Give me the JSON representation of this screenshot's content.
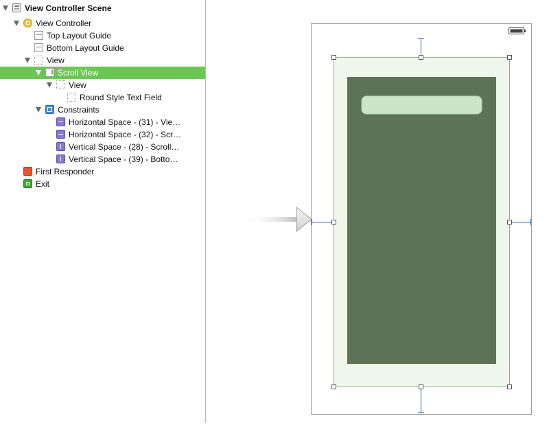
{
  "outline": {
    "items": [
      {
        "label": "View Controller Scene",
        "icon": "scene-icon",
        "level": 0,
        "expanded": true,
        "selected": false
      },
      {
        "label": "View Controller",
        "icon": "view-controller-icon",
        "level": 1,
        "expanded": true,
        "selected": false
      },
      {
        "label": "Top Layout Guide",
        "icon": "layout-guide-icon",
        "level": 2,
        "expanded": null,
        "selected": false
      },
      {
        "label": "Bottom Layout Guide",
        "icon": "layout-guide-icon",
        "level": 2,
        "expanded": null,
        "selected": false
      },
      {
        "label": "View",
        "icon": "view-icon",
        "level": 2,
        "expanded": true,
        "selected": false
      },
      {
        "label": "Scroll View",
        "icon": "scroll-view-icon",
        "level": 3,
        "expanded": true,
        "selected": true
      },
      {
        "label": "View",
        "icon": "view-icon",
        "level": 4,
        "expanded": true,
        "selected": false
      },
      {
        "label": "Round Style Text Field",
        "icon": "text-field-icon",
        "level": 5,
        "expanded": null,
        "selected": false
      },
      {
        "label": "Constraints",
        "icon": "constraints-icon",
        "level": 3,
        "expanded": true,
        "selected": false
      },
      {
        "label": "Horizontal Space - (31) - Vie…",
        "icon": "horizontal-space-icon",
        "level": 4,
        "expanded": null,
        "selected": false
      },
      {
        "label": "Horizontal Space - (32) - Scr…",
        "icon": "horizontal-space-icon",
        "level": 4,
        "expanded": null,
        "selected": false
      },
      {
        "label": "Vertical Space - (28) - Scroll…",
        "icon": "vertical-space-icon",
        "level": 4,
        "expanded": null,
        "selected": false
      },
      {
        "label": "Vertical Space - (39) - Botto…",
        "icon": "vertical-space-icon",
        "level": 4,
        "expanded": null,
        "selected": false
      },
      {
        "label": "First Responder",
        "icon": "first-responder-icon",
        "level": 1,
        "expanded": null,
        "selected": false
      },
      {
        "label": "Exit",
        "icon": "exit-icon",
        "level": 1,
        "expanded": null,
        "selected": false
      }
    ]
  },
  "colors": {
    "selection": "#6cc655",
    "scroll_view_fill": "#eff7ec",
    "inner_view_fill": "#5d7355",
    "text_field_fill": "#cce4c8",
    "constraint_blue": "#2a5a9c"
  }
}
